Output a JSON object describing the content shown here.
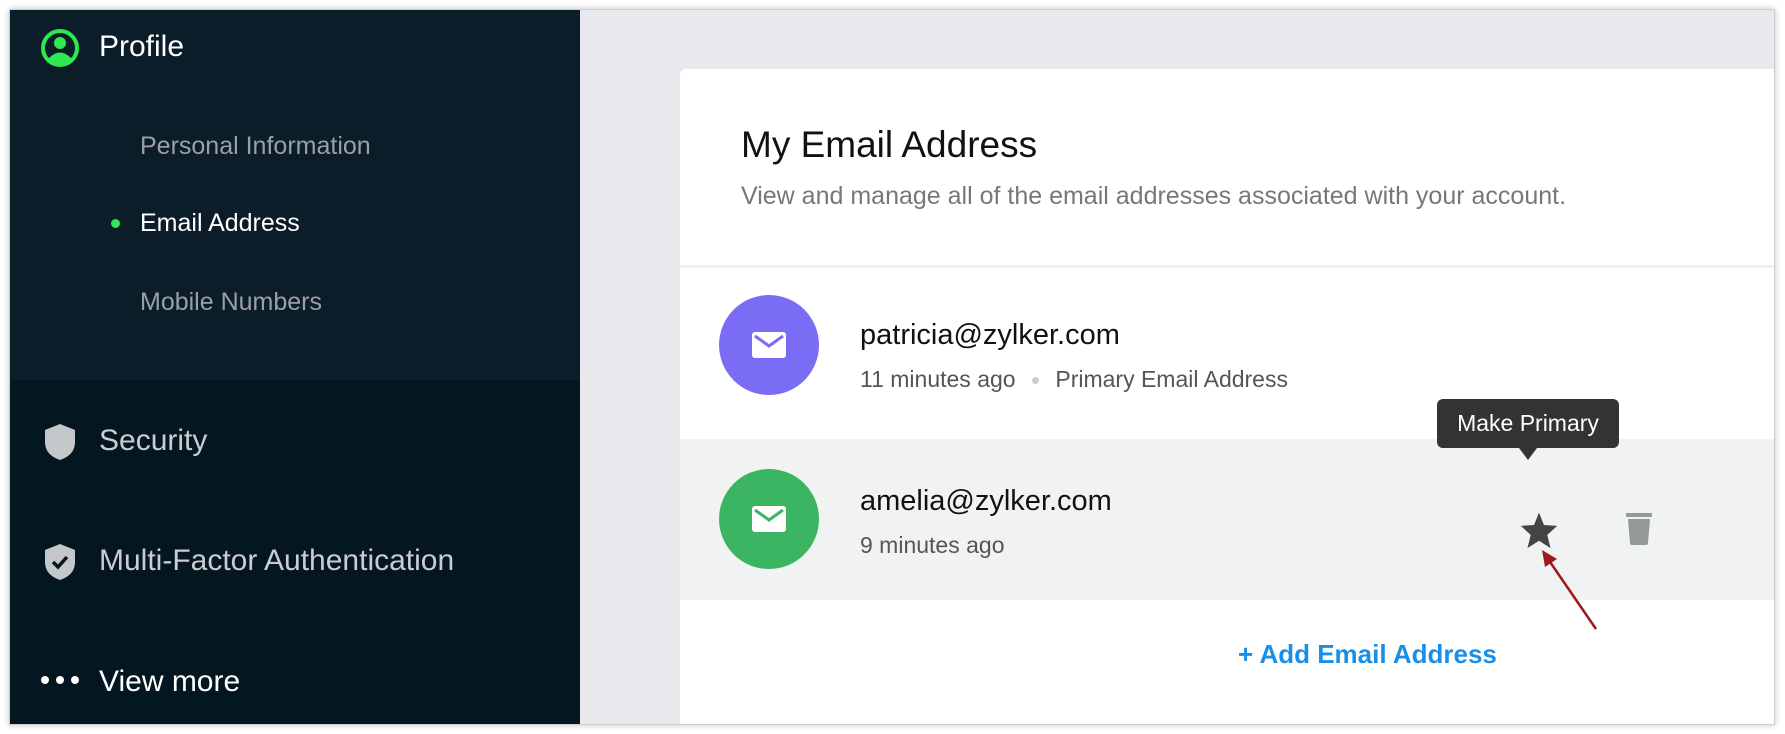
{
  "sidebar": {
    "profile": {
      "label": "Profile",
      "icon": "user-circle-icon"
    },
    "sub_items": [
      {
        "label": "Personal Information",
        "active": false
      },
      {
        "label": "Email Address",
        "active": true
      },
      {
        "label": "Mobile Numbers",
        "active": false
      }
    ],
    "security": {
      "label": "Security",
      "icon": "shield-icon"
    },
    "mfa": {
      "label": "Multi-Factor Authentication",
      "icon": "shield-check-icon"
    },
    "view_more": {
      "label": "View more",
      "icon": "more-dots-icon"
    }
  },
  "main": {
    "title": "My Email Address",
    "subtitle": "View and manage all of the email addresses associated with your account.",
    "emails": [
      {
        "address": "patricia@zylker.com",
        "time": "11 minutes ago",
        "tag": "Primary Email Address",
        "color": "#7b6cf6"
      },
      {
        "address": "amelia@zylker.com",
        "time": "9 minutes ago",
        "color": "#3cb563"
      }
    ],
    "tooltip": "Make Primary",
    "add_label": "+ Add Email Address"
  },
  "colors": {
    "accent_green": "#2ee84f",
    "link": "#1a8fe8",
    "sidebar": "#0b1d29"
  }
}
